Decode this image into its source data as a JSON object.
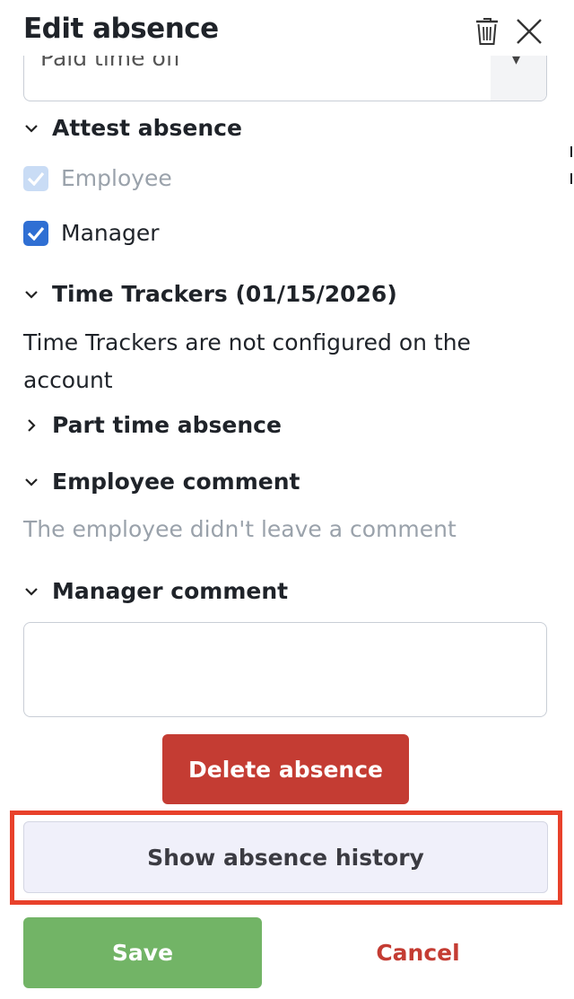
{
  "header": {
    "title": "Edit absence",
    "trash_icon": "trash-icon",
    "close_icon": "close-icon"
  },
  "absence_type": {
    "value": "Paid time off"
  },
  "attest": {
    "heading": "Attest absence",
    "employee_label": "Employee",
    "employee_checked": true,
    "employee_disabled": true,
    "manager_label": "Manager",
    "manager_checked": true
  },
  "time_trackers": {
    "heading": "Time Trackers (01/15/2026)",
    "message": "Time Trackers are not configured on the account"
  },
  "part_time": {
    "heading": "Part time absence"
  },
  "employee_comment": {
    "heading": "Employee comment",
    "message": "The employee didn't leave a comment"
  },
  "manager_comment": {
    "heading": "Manager comment",
    "value": ""
  },
  "actions": {
    "delete_label": "Delete absence",
    "history_label": "Show absence history",
    "save_label": "Save",
    "cancel_label": "Cancel"
  },
  "colors": {
    "delete": "#c43c33",
    "save": "#72b466",
    "checkbox": "#2f6fd3",
    "highlight": "#e8412b"
  }
}
